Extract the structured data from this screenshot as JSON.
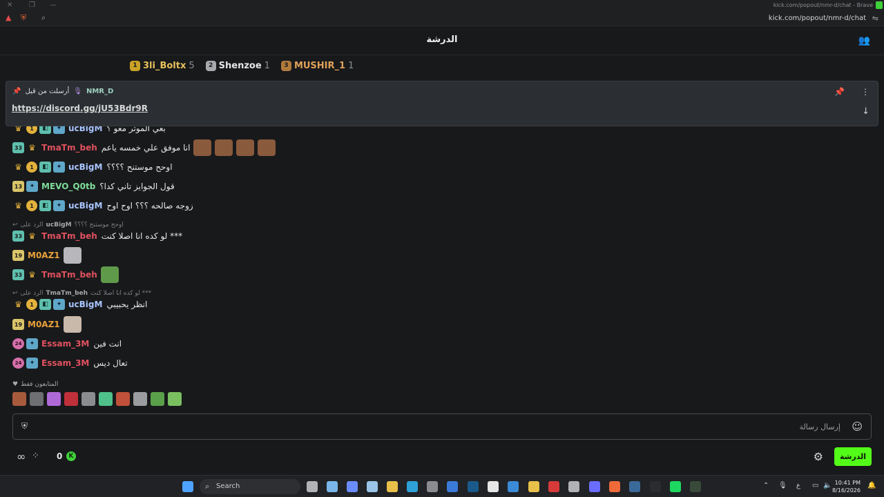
{
  "browser": {
    "window_title": "kick.com/popout/nmr-d/chat - Brave",
    "url": "kick.com/popout/nmr-d/chat"
  },
  "chat": {
    "header_title": "الدرشة",
    "leaderboard": [
      {
        "rank": "1",
        "name": "3li_Boltx",
        "count": "5",
        "color": "#c9a227"
      },
      {
        "rank": "2",
        "name": "Shenzoe",
        "count": "1",
        "color": "#a9aaad"
      },
      {
        "rank": "3",
        "name": "MUSHIR_1",
        "count": "1",
        "color": "#b07b3c"
      }
    ],
    "pinned": {
      "label": "أرسلت من قبل",
      "user": "NMR_D",
      "link": "https://discord.gg/jU53Bdr9R"
    },
    "messages": [
      {
        "badges": [
          "crown",
          "circle:1",
          "blue",
          "teal"
        ],
        "user": "ucBigM",
        "color": "#a9c4ff",
        "text": "بعي الموتر معو ؟"
      },
      {
        "badges": [
          "sq:33",
          "crown"
        ],
        "user": "TmaTm_beh",
        "color": "#e0515e",
        "text": "انا موفق علي خمسه ياعم"
      },
      {
        "badges": [
          "crown",
          "circle:1",
          "blue",
          "teal"
        ],
        "user": "ucBigM",
        "color": "#a9c4ff",
        "text": "اوحح موستنح ؟؟؟؟"
      },
      {
        "badges": [
          "sq:13",
          "teal"
        ],
        "user": "MEVO_Q0tb",
        "color": "#7fdd9a",
        "text": "قول الجوايز تاني كدا؟"
      },
      {
        "badges": [
          "crown",
          "circle:1",
          "blue",
          "teal"
        ],
        "user": "ucBigM",
        "color": "#a9c4ff",
        "text": "زوجه صالحه ؟؟؟ اوح اوح"
      },
      {
        "badges": [
          "sq:33",
          "crown"
        ],
        "user": "TmaTm_beh",
        "color": "#e0515e",
        "text": "لو كده انا اصلا كنت ***"
      },
      {
        "badges": [
          "sq:19"
        ],
        "user": "M0AZ1",
        "color": "#e9a13a",
        "text": ""
      },
      {
        "badges": [
          "sq:33",
          "crown"
        ],
        "user": "TmaTm_beh",
        "color": "#e0515e",
        "text": ""
      },
      {
        "badges": [
          "crown",
          "circle:1",
          "blue",
          "teal"
        ],
        "user": "ucBigM",
        "color": "#a9c4ff",
        "text": "انظر يحبيبي"
      },
      {
        "badges": [
          "sq:19"
        ],
        "user": "M0AZ1",
        "color": "#e9a13a",
        "text": ""
      },
      {
        "badges": [
          "pink:24",
          "teal"
        ],
        "user": "Essam_3M",
        "color": "#e0515e",
        "text": "انت فين"
      },
      {
        "badges": [
          "pink:24",
          "teal"
        ],
        "user": "Essam_3M",
        "color": "#e0515e",
        "text": "تعال ديس"
      }
    ],
    "replies": [
      {
        "prefix": "الرد على",
        "user": "ucBigM",
        "text": "اوحح موستنح ؟؟؟؟"
      },
      {
        "prefix": "الرد على",
        "user": "TmaTm_beh",
        "text": "لو كده انا اصلا كنت ***"
      }
    ],
    "emote_tray_label": "المتابعون فقط",
    "input_placeholder": "إرسال رسالة",
    "send_button": "الدرشة",
    "points": "0"
  },
  "taskbar": {
    "search_label": "Search",
    "time": "10:41 PM",
    "date": "8/16/2026"
  },
  "colors": {
    "accent": "#53fc18",
    "background": "#18191b"
  }
}
